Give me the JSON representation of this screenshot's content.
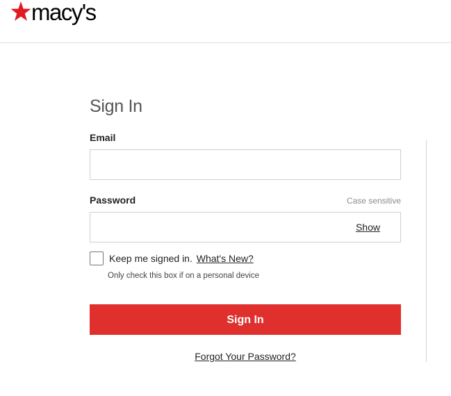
{
  "brand": {
    "name": "macy's",
    "star_color": "#e21a22"
  },
  "form": {
    "title": "Sign In",
    "email": {
      "label": "Email",
      "value": "",
      "placeholder": ""
    },
    "password": {
      "label": "Password",
      "note": "Case sensitive",
      "value": "",
      "show_label": "Show"
    },
    "keep_signed_in": {
      "label": "Keep me signed in.",
      "checked": false,
      "whats_new_label": "What's New?",
      "note": "Only check this box if on a personal device"
    },
    "submit_label": "Sign In",
    "forgot_label": "Forgot Your Password?"
  },
  "colors": {
    "accent": "#e0302e",
    "border": "#cfcfcf"
  }
}
